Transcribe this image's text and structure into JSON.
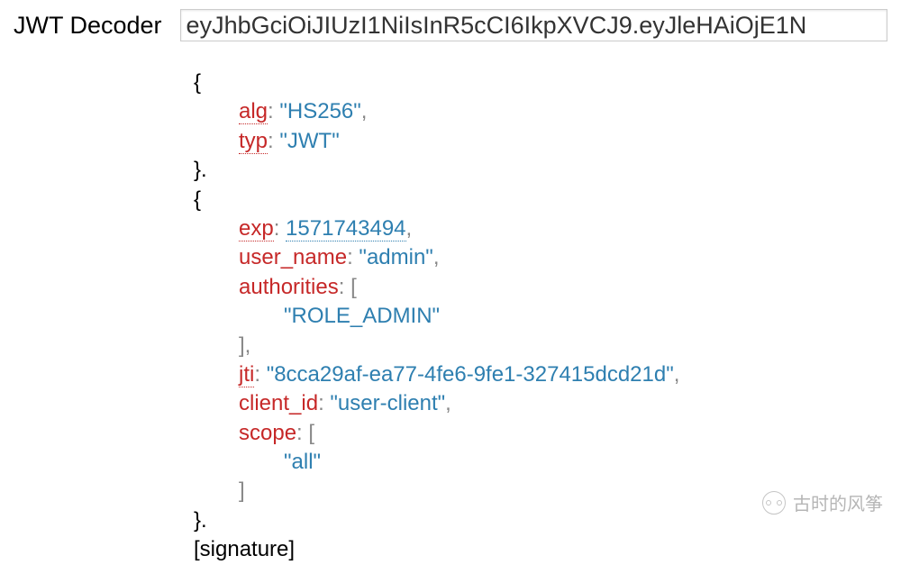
{
  "title": "JWT Decoder",
  "token": "eyJhbGciOiJIUzI1NiIsInR5cCI6IkpXVCJ9.eyJleHAiOjE1N",
  "header": {
    "alg_key": "alg",
    "alg_val": "\"HS256\"",
    "typ_key": "typ",
    "typ_val": "\"JWT\""
  },
  "payload": {
    "exp_key": "exp",
    "exp_val": "1571743494",
    "user_name_key": "user_name",
    "user_name_val": "\"admin\"",
    "authorities_key": "authorities",
    "authorities_val0": "\"ROLE_ADMIN\"",
    "jti_key": "jti",
    "jti_val": "\"8cca29af-ea77-4fe6-9fe1-327415dcd21d\"",
    "client_id_key": "client_id",
    "client_id_val": "\"user-client\"",
    "scope_key": "scope",
    "scope_val0": "\"all\""
  },
  "signature_label": "[signature]",
  "watermark": "古时的风筝"
}
